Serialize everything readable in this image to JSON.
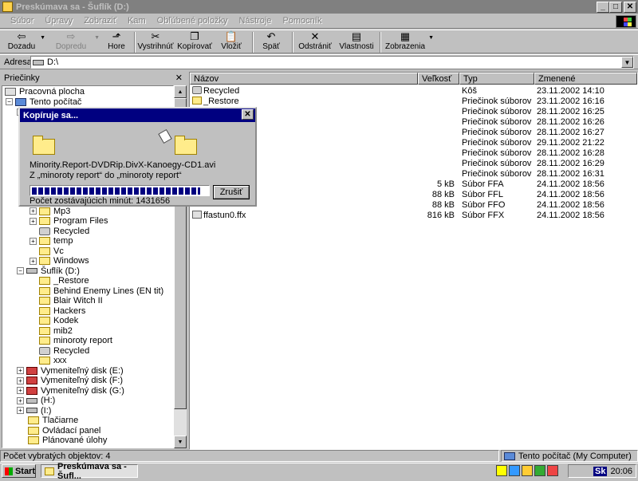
{
  "window": {
    "title": "Preskúmava sa - Šuflík (D:)",
    "icon": "explorer-folder-icon"
  },
  "menu": [
    "Súbor",
    "Úpravy",
    "Zobraziť",
    "Kam",
    "Obľúbené položky",
    "Nástroje",
    "Pomocník"
  ],
  "toolbar": {
    "back": "Dozadu",
    "forward": "Dopredu",
    "home": "Hore",
    "cut": "Vystrihnúť",
    "copy": "Kopírovať",
    "paste": "Vložiť",
    "undo": "Späť",
    "delete": "Odstrániť",
    "properties": "Vlastnosti",
    "views": "Zobrazenia"
  },
  "address": {
    "label": "Adresa",
    "value": "D:\\"
  },
  "tree": {
    "header": "Priečinky",
    "items": [
      {
        "label": "Pracovná plocha",
        "icon": "desktop-icon"
      },
      {
        "label": "Tento počítač",
        "icon": "computer-icon"
      },
      {
        "label": "Mp3",
        "icon": "folder-icon"
      },
      {
        "label": "Program Files",
        "icon": "folder-icon"
      },
      {
        "label": "Recycled",
        "icon": "recycle-bin-icon"
      },
      {
        "label": "temp",
        "icon": "folder-icon"
      },
      {
        "label": "Vc",
        "icon": "folder-icon"
      },
      {
        "label": "Windows",
        "icon": "folder-icon"
      },
      {
        "label": "Šuflík (D:)",
        "icon": "drive-icon"
      },
      {
        "label": "_Restore",
        "icon": "folder-icon"
      },
      {
        "label": "Behind Enemy Lines (EN tit)",
        "icon": "folder-icon"
      },
      {
        "label": "Blair Witch II",
        "icon": "folder-icon"
      },
      {
        "label": "Hackers",
        "icon": "folder-icon"
      },
      {
        "label": "Kodek",
        "icon": "folder-icon"
      },
      {
        "label": "mib2",
        "icon": "folder-icon"
      },
      {
        "label": "minoroty report",
        "icon": "folder-icon"
      },
      {
        "label": "Recycled",
        "icon": "recycle-bin-icon"
      },
      {
        "label": "xxx",
        "icon": "folder-icon"
      },
      {
        "label": "Vymeniteľný disk (E:)",
        "icon": "removable-disk-icon"
      },
      {
        "label": "Vymeniteľný disk (F:)",
        "icon": "removable-disk-icon"
      },
      {
        "label": "Vymeniteľný disk (G:)",
        "icon": "removable-disk-icon"
      },
      {
        "label": "(H:)",
        "icon": "cd-drive-icon"
      },
      {
        "label": "(I:)",
        "icon": "cd-drive-icon"
      },
      {
        "label": "Tlačiarne",
        "icon": "printers-icon"
      },
      {
        "label": "Ovládací panel",
        "icon": "control-panel-icon"
      },
      {
        "label": "Plánované úlohy",
        "icon": "scheduled-tasks-icon"
      }
    ]
  },
  "list": {
    "columns": [
      "Názov",
      "Veľkosť",
      "Typ",
      "Zmenené"
    ],
    "rows": [
      {
        "name": "Recycled",
        "size": "",
        "type": "Kôš",
        "modified": "23.11.2002 14:10"
      },
      {
        "name": "_Restore",
        "size": "",
        "type": "Priečinok súborov",
        "modified": "23.11.2002 16:16"
      },
      {
        "name": "es (EN tit)",
        "size": "",
        "type": "Priečinok súborov",
        "modified": "28.11.2002 16:25"
      },
      {
        "name": "",
        "size": "",
        "type": "Priečinok súborov",
        "modified": "28.11.2002 16:26"
      },
      {
        "name": "",
        "size": "",
        "type": "Priečinok súborov",
        "modified": "28.11.2002 16:27"
      },
      {
        "name": "",
        "size": "",
        "type": "Priečinok súborov",
        "modified": "29.11.2002 21:22"
      },
      {
        "name": "",
        "size": "",
        "type": "Priečinok súborov",
        "modified": "28.11.2002 16:28"
      },
      {
        "name": "",
        "size": "",
        "type": "Priečinok súborov",
        "modified": "28.11.2002 16:29"
      },
      {
        "name": "",
        "size": "",
        "type": "Priečinok súborov",
        "modified": "28.11.2002 16:31"
      },
      {
        "name": "",
        "size": "5 kB",
        "type": "Súbor FFA",
        "modified": "24.11.2002 18:56"
      },
      {
        "name": "",
        "size": "88 kB",
        "type": "Súbor FFL",
        "modified": "24.11.2002 18:56"
      },
      {
        "name": "",
        "size": "88 kB",
        "type": "Súbor FFO",
        "modified": "24.11.2002 18:56"
      },
      {
        "name": "ffastun0.ffx",
        "size": "816 kB",
        "type": "Súbor FFX",
        "modified": "24.11.2002 18:56"
      }
    ]
  },
  "dialog": {
    "title": "Kopíruje sa...",
    "file": "Minority.Report-DVDRip.DivX-Kanoegy-CD1.avi",
    "route": "Z „minoroty report“ do „minoroty report“",
    "remaining": "Počet zostávajúcich minút: 1431656",
    "cancel": "Zrušiť",
    "progress": 0.96
  },
  "status": {
    "left": "Počet vybratých objektov: 4",
    "right": "Tento počítač (My Computer)"
  },
  "taskbar": {
    "start": "Start",
    "task": "Preskúmava sa - Šufl...",
    "clock": "20:06",
    "lang": "Sk"
  }
}
